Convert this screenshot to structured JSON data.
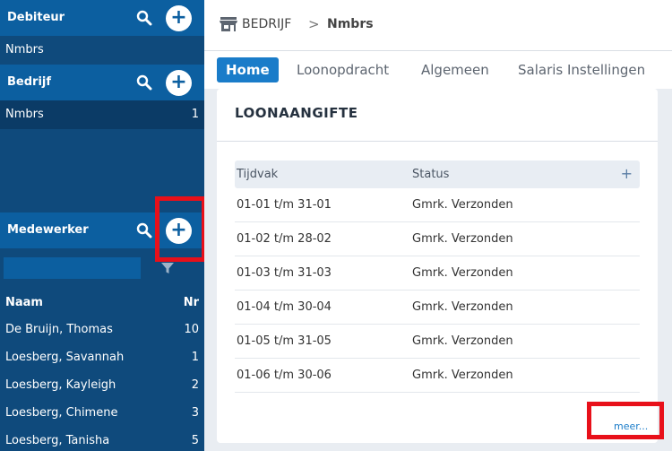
{
  "sidebar": {
    "debiteur": {
      "title": "Debiteur",
      "item": "Nmbrs"
    },
    "bedrijf": {
      "title": "Bedrijf",
      "item": "Nmbrs",
      "count": "1"
    },
    "medewerker": {
      "title": "Medewerker",
      "filter_value": "",
      "col_name": "Naam",
      "col_nr": "Nr",
      "rows": [
        {
          "name": "De Bruijn, Thomas",
          "nr": "10"
        },
        {
          "name": "Loesberg, Savannah",
          "nr": "1"
        },
        {
          "name": "Loesberg, Kayleigh",
          "nr": "2"
        },
        {
          "name": "Loesberg, Chimene",
          "nr": "3"
        },
        {
          "name": "Loesberg, Tanisha",
          "nr": "5"
        }
      ]
    },
    "add_symbol": "+"
  },
  "breadcrumb": {
    "level1": "BEDRIJF",
    "separator": ">",
    "level2": "Nmbrs"
  },
  "tabs": [
    {
      "label": "Home",
      "active": true
    },
    {
      "label": "Loonopdracht",
      "active": false
    },
    {
      "label": "Algemeen",
      "active": false
    },
    {
      "label": "Salaris Instellingen",
      "active": false
    }
  ],
  "card": {
    "title": "LOONAANGIFTE",
    "col_tijdvak": "Tijdvak",
    "col_status": "Status",
    "add_symbol": "+",
    "rows": [
      {
        "tijdvak": "01-01 t/m 31-01",
        "status": "Gmrk. Verzonden"
      },
      {
        "tijdvak": "01-02 t/m 28-02",
        "status": "Gmrk. Verzonden"
      },
      {
        "tijdvak": "01-03 t/m 31-03",
        "status": "Gmrk. Verzonden"
      },
      {
        "tijdvak": "01-04 t/m 30-04",
        "status": "Gmrk. Verzonden"
      },
      {
        "tijdvak": "01-05 t/m 31-05",
        "status": "Gmrk. Verzonden"
      },
      {
        "tijdvak": "01-06 t/m 30-06",
        "status": "Gmrk. Verzonden"
      }
    ],
    "more_link": "meer..."
  },
  "colors": {
    "sidebar_bg": "#0f4a7c",
    "sidebar_header": "#0c5fa0",
    "accent": "#1a7cc9",
    "highlight": "#e8101a"
  },
  "icons": [
    "search-icon",
    "add-icon",
    "filter-icon",
    "store-icon",
    "chevron-right-icon"
  ]
}
